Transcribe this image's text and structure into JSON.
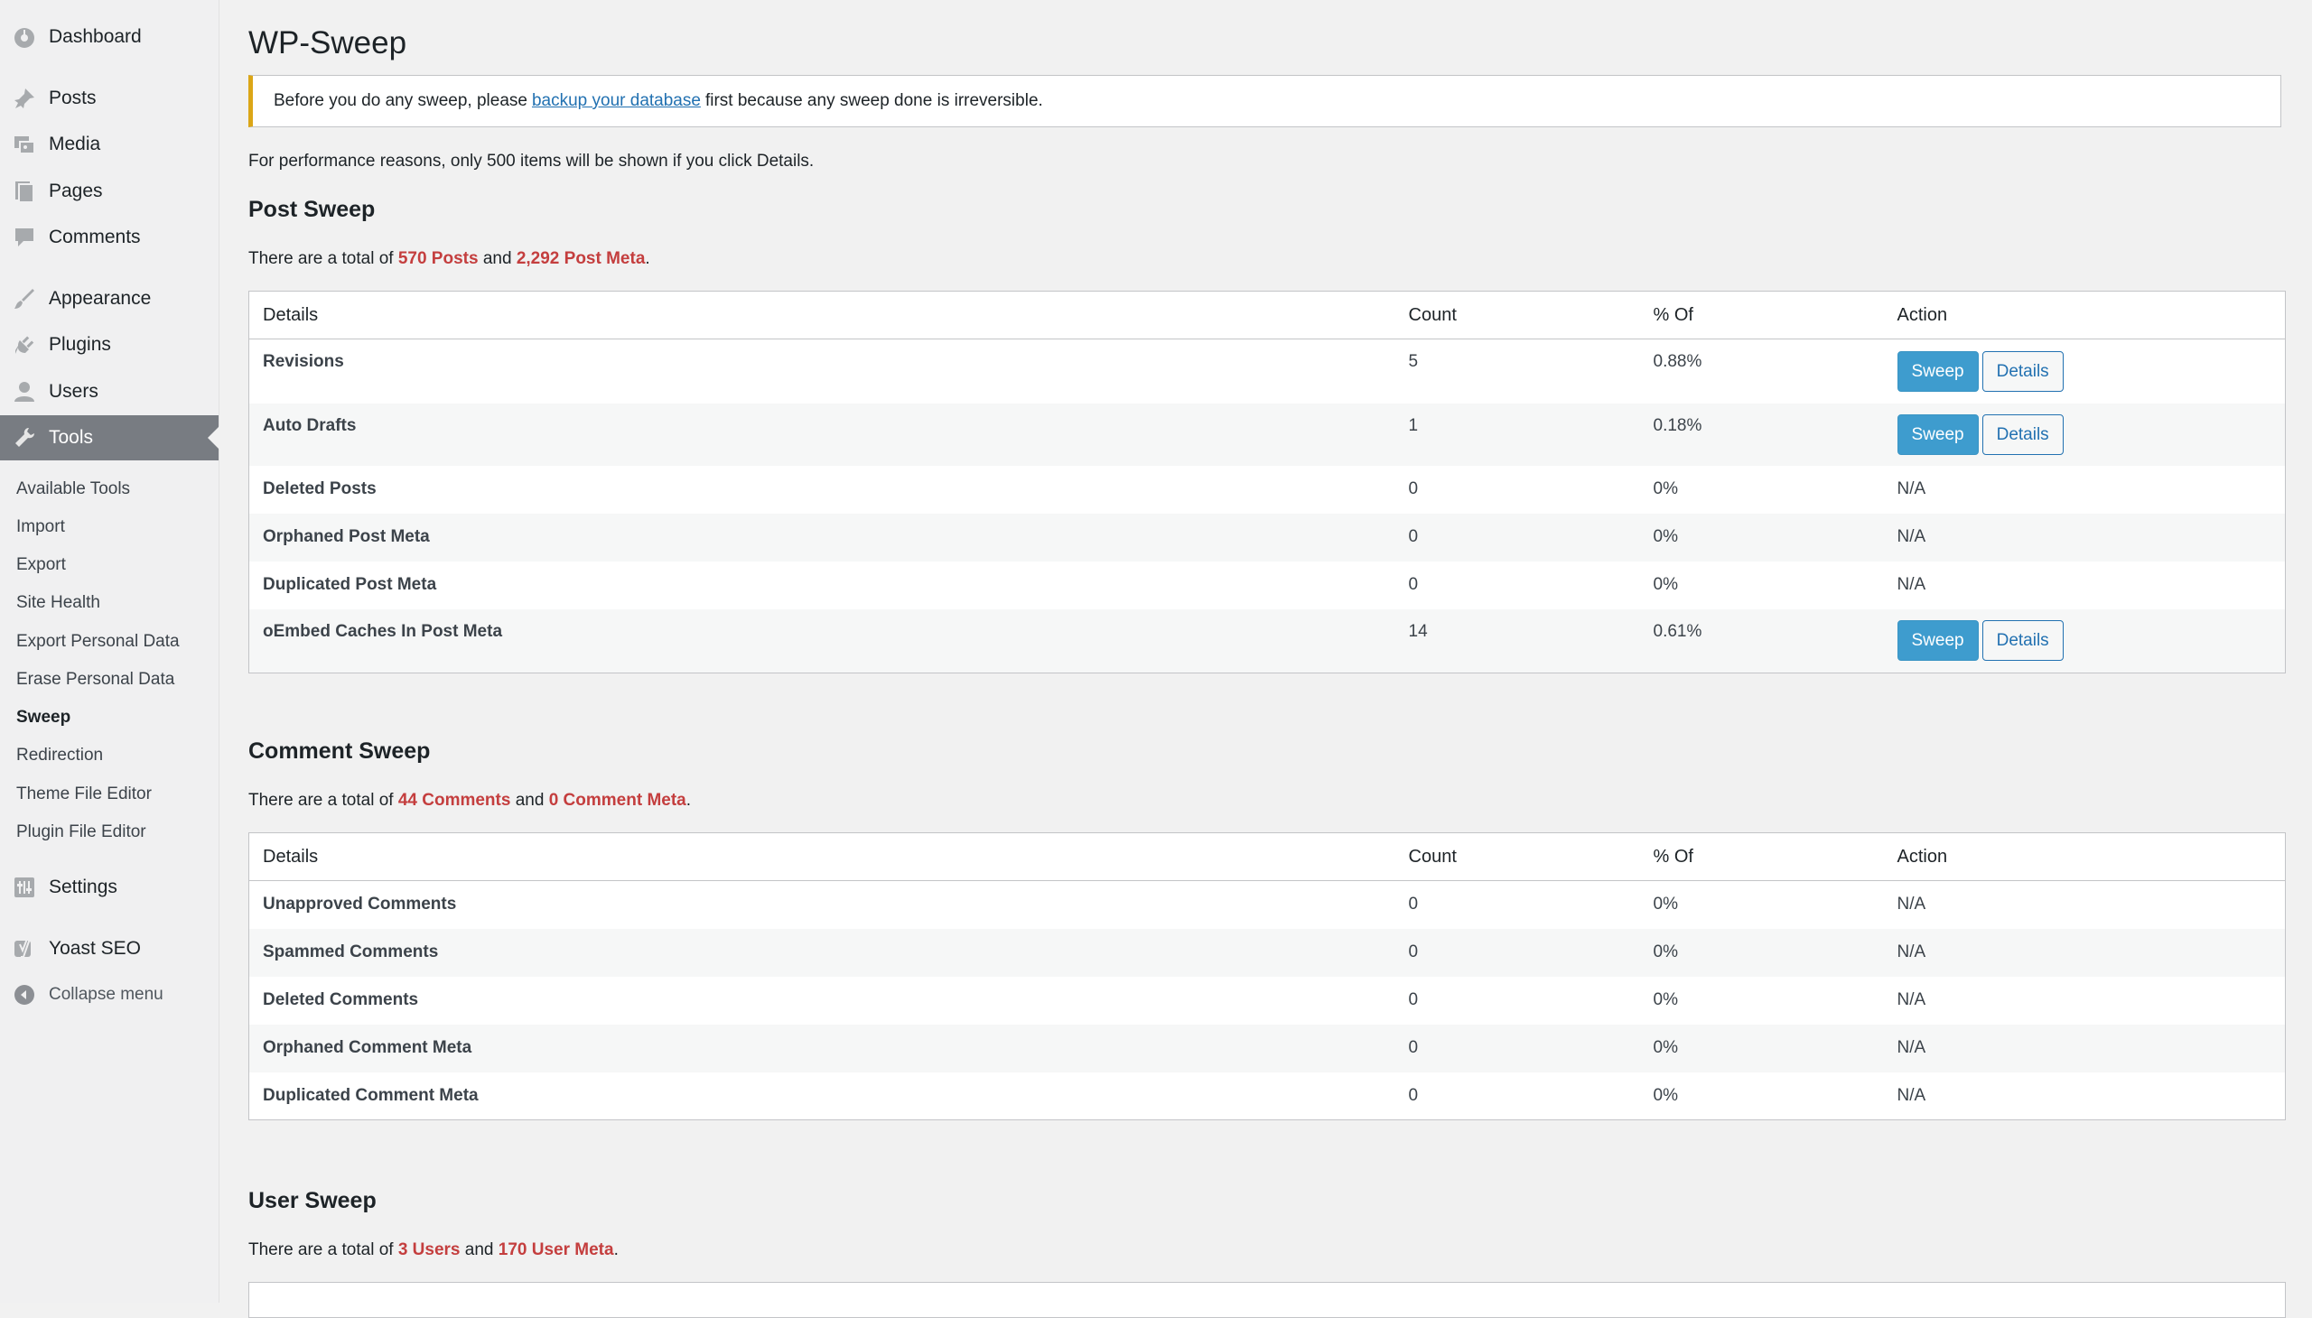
{
  "sidebar": {
    "menu": [
      {
        "label": "Dashboard",
        "icon": "dashboard-icon"
      },
      {
        "label": "Posts",
        "icon": "pin-icon"
      },
      {
        "label": "Media",
        "icon": "media-icon"
      },
      {
        "label": "Pages",
        "icon": "pages-icon"
      },
      {
        "label": "Comments",
        "icon": "comments-icon"
      },
      {
        "label": "Appearance",
        "icon": "brush-icon"
      },
      {
        "label": "Plugins",
        "icon": "plugin-icon"
      },
      {
        "label": "Users",
        "icon": "user-icon"
      },
      {
        "label": "Tools",
        "icon": "wrench-icon"
      }
    ],
    "tools_submenu": [
      "Available Tools",
      "Import",
      "Export",
      "Site Health",
      "Export Personal Data",
      "Erase Personal Data",
      "Sweep",
      "Redirection",
      "Theme File Editor",
      "Plugin File Editor"
    ],
    "settings_label": "Settings",
    "yoast_label": "Yoast SEO",
    "collapse_label": "Collapse menu"
  },
  "main": {
    "title": "WP-Sweep",
    "notice": {
      "before": "Before you do any sweep, please",
      "link": "backup your database",
      "after": "first because any sweep done is irreversible."
    },
    "perf_note": "For performance reasons, only 500 items will be shown if you click Details.",
    "headers": {
      "details": "Details",
      "count": "Count",
      "pct": "% Of",
      "action": "Action"
    },
    "buttons": {
      "sweep": "Sweep",
      "details": "Details",
      "na": "N/A"
    },
    "post_sweep": {
      "title": "Post Sweep",
      "totals": {
        "prefix": "There are a total of",
        "a": "570 Posts",
        "mid": "and",
        "b": "2,292 Post Meta",
        "end": "."
      },
      "rows": [
        {
          "name": "Revisions",
          "count": "5",
          "pct": "0.88%"
        },
        {
          "name": "Auto Drafts",
          "count": "1",
          "pct": "0.18%"
        },
        {
          "name": "Deleted Posts",
          "count": "0",
          "pct": "0%"
        },
        {
          "name": "Orphaned Post Meta",
          "count": "0",
          "pct": "0%"
        },
        {
          "name": "Duplicated Post Meta",
          "count": "0",
          "pct": "0%"
        },
        {
          "name": "oEmbed Caches In Post Meta",
          "count": "14",
          "pct": "0.61%"
        }
      ]
    },
    "comment_sweep": {
      "title": "Comment Sweep",
      "totals": {
        "prefix": "There are a total of",
        "a": "44 Comments",
        "mid": "and",
        "b": "0 Comment Meta",
        "end": "."
      },
      "rows": [
        {
          "name": "Unapproved Comments",
          "count": "0",
          "pct": "0%"
        },
        {
          "name": "Spammed Comments",
          "count": "0",
          "pct": "0%"
        },
        {
          "name": "Deleted Comments",
          "count": "0",
          "pct": "0%"
        },
        {
          "name": "Orphaned Comment Meta",
          "count": "0",
          "pct": "0%"
        },
        {
          "name": "Duplicated Comment Meta",
          "count": "0",
          "pct": "0%"
        }
      ]
    },
    "user_sweep": {
      "title": "User Sweep",
      "totals": {
        "prefix": "There are a total of",
        "a": "3 Users",
        "mid": "and",
        "b": "170 User Meta",
        "end": "."
      }
    }
  }
}
